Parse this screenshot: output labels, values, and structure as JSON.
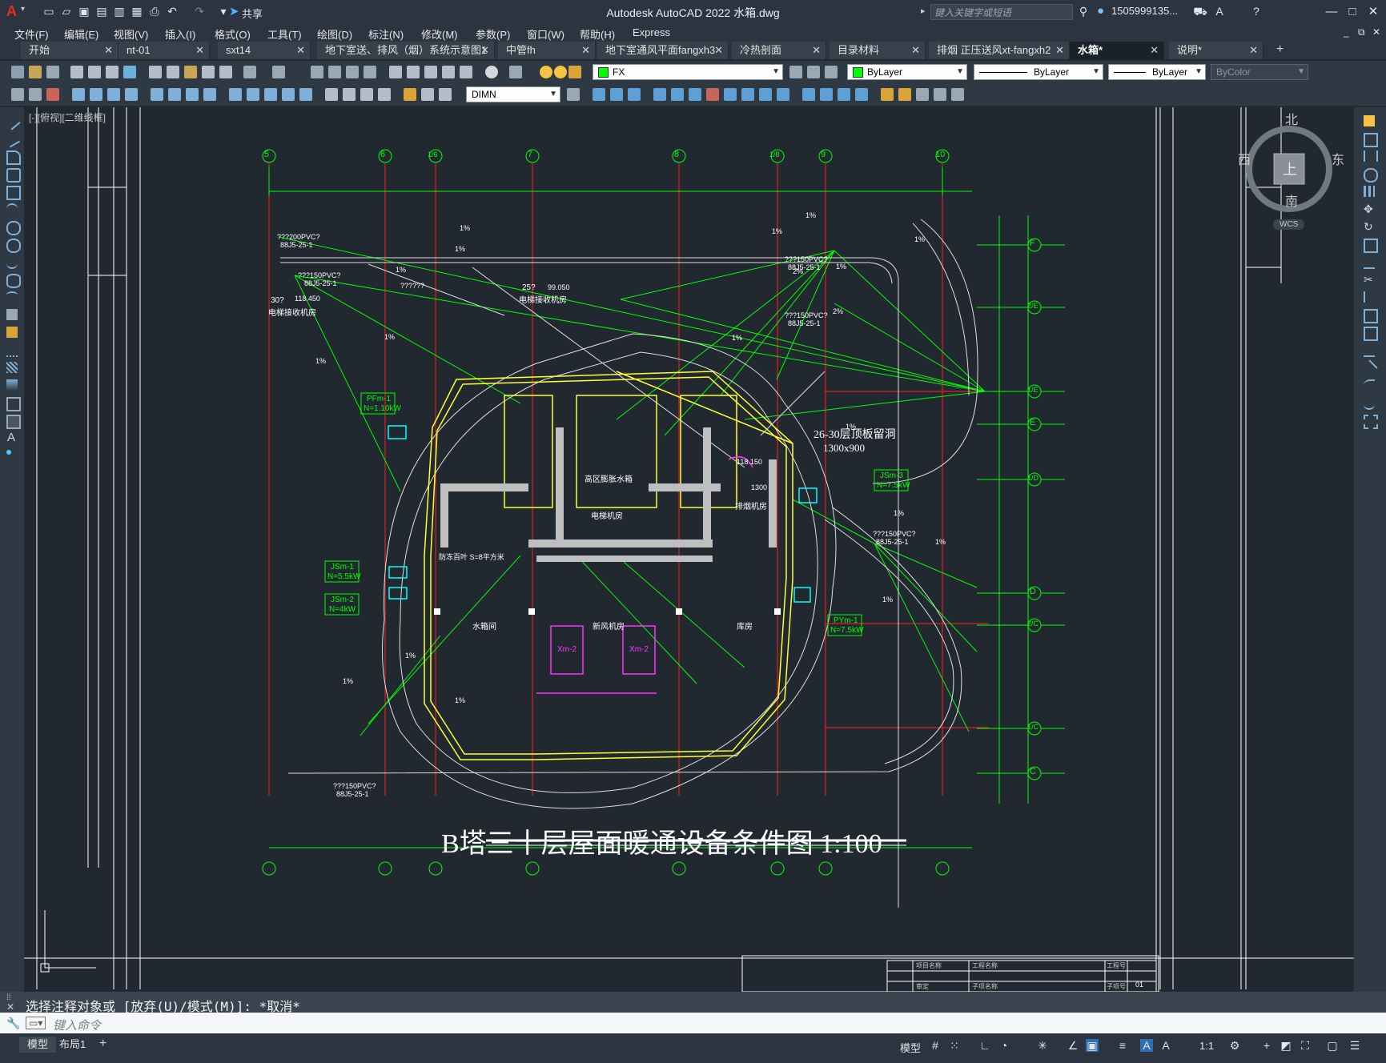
{
  "app": {
    "title": "Autodesk AutoCAD 2022    水箱.dwg",
    "logo": "A",
    "share_label": "共享",
    "search_placeholder": "键入关键字或短语",
    "user": "1505999135...",
    "help_icon": "help-icon"
  },
  "menu": [
    "文件(F)",
    "编辑(E)",
    "视图(V)",
    "插入(I)",
    "格式(O)",
    "工具(T)",
    "绘图(D)",
    "标注(N)",
    "修改(M)",
    "参数(P)",
    "窗口(W)",
    "帮助(H)",
    "Express"
  ],
  "tabs": [
    {
      "label": "开始",
      "active": false
    },
    {
      "label": "nt-01",
      "active": false
    },
    {
      "label": "sxt14",
      "active": false
    },
    {
      "label": "地下室送、排风（烟）系统示意图1",
      "active": false
    },
    {
      "label": "中管fh",
      "active": false
    },
    {
      "label": "地下室通风平面fangxh3",
      "active": false
    },
    {
      "label": "冷热剖面",
      "active": false
    },
    {
      "label": "目录材料",
      "active": false
    },
    {
      "label": "排烟 正压送风xt-fangxh2",
      "active": false
    },
    {
      "label": "水箱*",
      "active": true
    },
    {
      "label": "说明*",
      "active": false
    }
  ],
  "toolbar": {
    "layer": "FX",
    "layer_color": "#00ff00",
    "color": "ByLayer",
    "linetype": "ByLayer",
    "lineweight": "ByLayer",
    "plotstyle": "ByColor",
    "dimstyle": "DIMN"
  },
  "viewport": {
    "label": "[-][俯视][二维线框]",
    "compass": {
      "n": "北",
      "s": "南",
      "e": "东",
      "w": "西",
      "top": "上",
      "wcs": "WCS"
    }
  },
  "drawing": {
    "title": "B塔三十层屋面暖通设备条件图 1:100",
    "grid_top": [
      "5",
      "6",
      "1/6",
      "7",
      "8",
      "1/8",
      "9",
      "10"
    ],
    "grid_right": [
      "F",
      "2/E",
      "1/E",
      "E",
      "1/D",
      "D",
      "2/C",
      "1/C",
      "C"
    ],
    "annotations": [
      "26-30层顶板留洞",
      "1300x900",
      "PFm-1",
      "N=1.10kW",
      "JSm-1",
      "N=5.5kW",
      "JSm-2",
      "N=4kW",
      "JSm-3",
      "N=7.5kW",
      "PYm-1",
      "N=7.5kW",
      "Xm-2",
      "水箱间",
      "新风机房",
      "库房",
      "电梯机房",
      "高区膨胀水箱",
      "排烟机房",
      "???200PVC?",
      "???150PVC?",
      "88J5-25-1",
      "1%",
      "2%",
      "30?",
      "25?",
      "99.050",
      "118.450",
      "118.150",
      "1300",
      "????",
      "??????",
      "电梯接收机房",
      "防冻百叶 S=8平方米"
    ],
    "titleblock": [
      "项目名称",
      "工程名称",
      "子项名称",
      "审定",
      "工程号",
      "子项号",
      "01"
    ]
  },
  "command": {
    "history": "选择注释对象或 [放弃(U)/模式(M)]: *取消*",
    "placeholder": "键入命令"
  },
  "status": {
    "layout_tabs": [
      "模型",
      "布局1"
    ],
    "model_label": "模型",
    "scale": "1:1"
  }
}
